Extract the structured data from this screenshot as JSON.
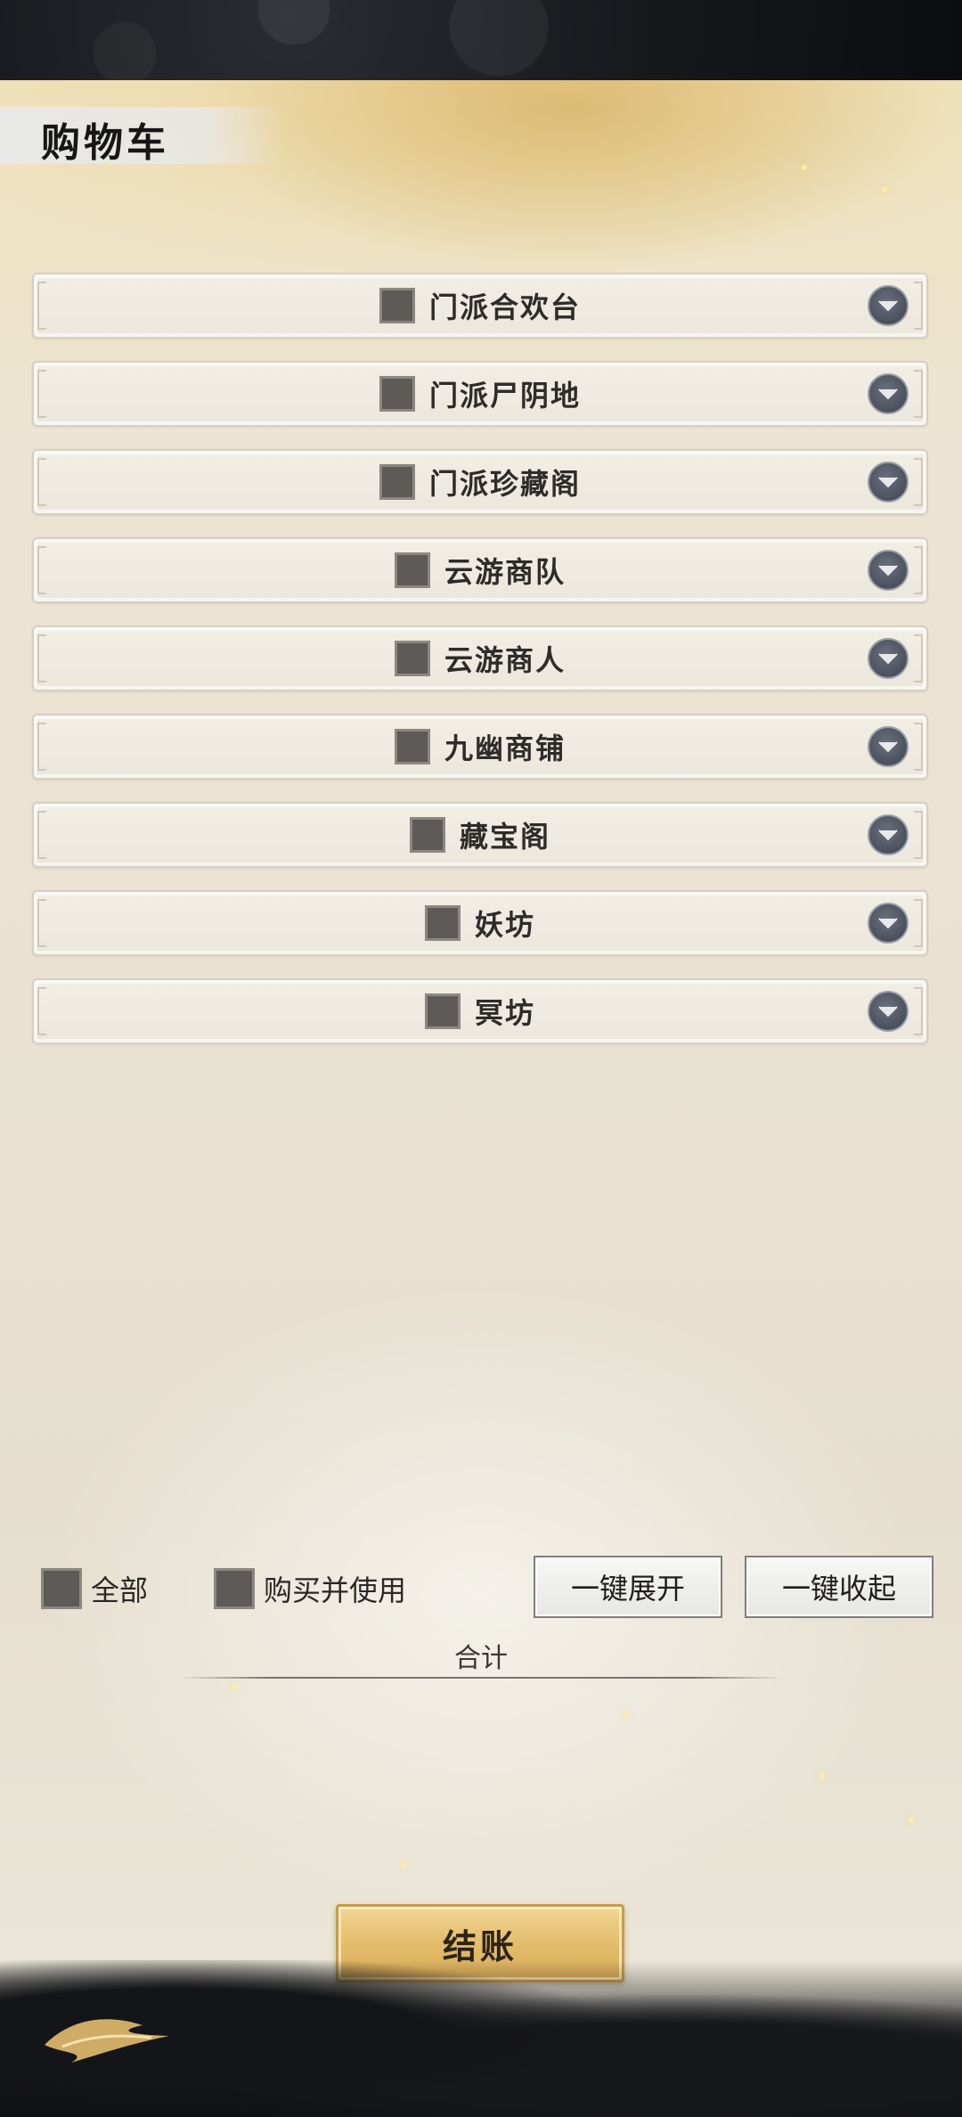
{
  "header": {
    "title": "购物车"
  },
  "categories": [
    {
      "label": "门派合欢台",
      "checked": false
    },
    {
      "label": "门派尸阴地",
      "checked": false
    },
    {
      "label": "门派珍藏阁",
      "checked": false
    },
    {
      "label": "云游商队",
      "checked": false
    },
    {
      "label": "云游商人",
      "checked": false
    },
    {
      "label": "九幽商铺",
      "checked": false
    },
    {
      "label": "藏宝阁",
      "checked": false
    },
    {
      "label": "妖坊",
      "checked": false
    },
    {
      "label": "冥坊",
      "checked": false
    }
  ],
  "controls": {
    "select_all_label": "全部",
    "buy_and_use_label": "购买并使用",
    "expand_all_label": "一键展开",
    "collapse_all_label": "一键收起"
  },
  "summary": {
    "total_label": "合计"
  },
  "checkout": {
    "label": "结账"
  },
  "icons": {
    "expand": "chevron-down-icon",
    "emblem": "golden-emblem-icon"
  },
  "colors": {
    "accent_gold": "#e5bf6f",
    "checkbox": "#5d5a57",
    "expand_button": "#4a505c"
  }
}
